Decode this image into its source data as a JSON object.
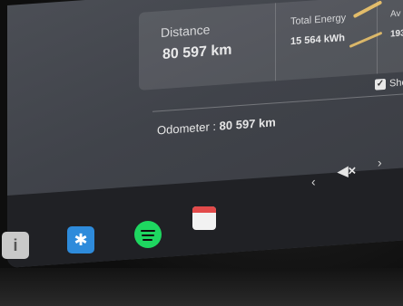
{
  "trip_stats": {
    "distance": {
      "label": "Distance",
      "value": "80 597 km"
    },
    "total_energy": {
      "label": "Total Energy",
      "value": "15 564 kWh"
    },
    "average": {
      "label": "Av",
      "value": "193"
    }
  },
  "show_toggle": {
    "label": "Sho",
    "checked": true,
    "checkmark": "✓"
  },
  "odometer": {
    "label": "Odometer : ",
    "value": "80 597 km"
  },
  "taskbar": {
    "info_icon_glyph": "i",
    "bluetooth_icon_glyph": "✱",
    "prev_glyph": "‹",
    "volume_glyph": "◀×",
    "next_glyph": "›"
  },
  "colors": {
    "bluetooth": "#2e8bdb",
    "spotify": "#1ed760",
    "calendar_accent": "#e24a4a"
  }
}
